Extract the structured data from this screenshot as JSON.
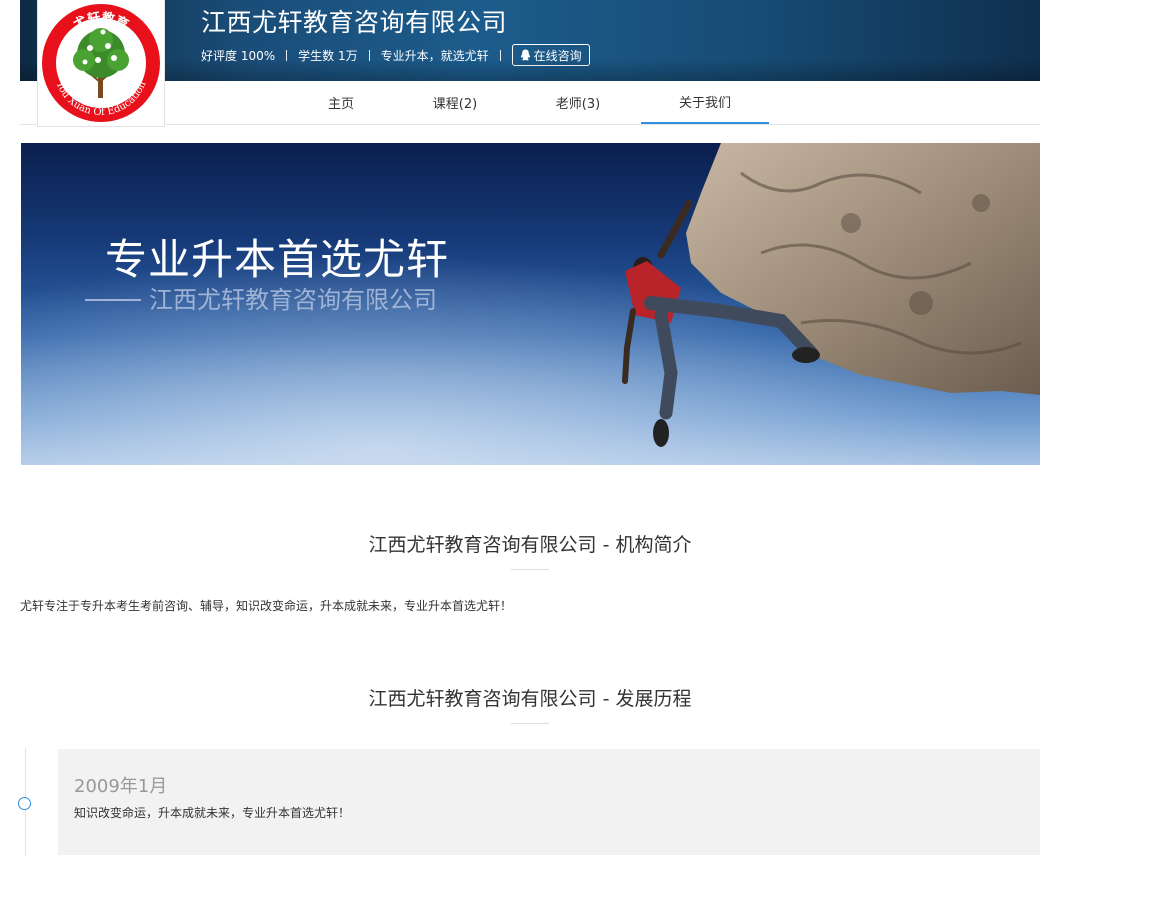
{
  "header": {
    "org_name": "江西尤轩教育咨询有限公司",
    "rating": "好评度 100%",
    "students": "学生数 1万",
    "slogan": "专业升本，就选尤轩",
    "consult_label": "在线咨询",
    "consult_icon": "qq-icon"
  },
  "logo": {
    "top_text": "尤轩教育",
    "bottom_text": "You Xuan Of Education",
    "colors": {
      "ring": "#e8111b",
      "tree": "#3c8b2a",
      "trunk": "#7a4a1e"
    }
  },
  "nav": {
    "items": [
      {
        "label": "主页"
      },
      {
        "label": "课程(2)"
      },
      {
        "label": "老师(3)"
      },
      {
        "label": "关于我们"
      }
    ],
    "active_index": 3,
    "accent": "#2f8fe0"
  },
  "banner": {
    "title": "专业升本首选尤轩",
    "subtitle": "江西尤轩教育咨询有限公司"
  },
  "intro": {
    "title": "江西尤轩教育咨询有限公司 - 机构简介",
    "text": "尤轩专注于专升本考生考前咨询、辅导，知识改变命运，升本成就未来，专业升本首选尤轩！"
  },
  "history": {
    "title": "江西尤轩教育咨询有限公司 - 发展历程",
    "events": [
      {
        "date": "2009年1月",
        "desc": "知识改变命运，升本成就未来，专业升本首选尤轩！"
      }
    ]
  }
}
